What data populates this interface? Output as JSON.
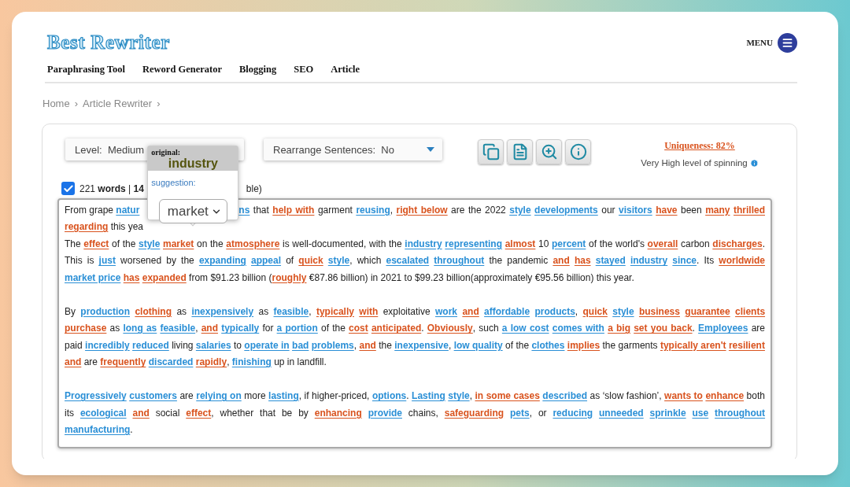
{
  "logo": "Best Rewriter",
  "menu": {
    "label": "MENU"
  },
  "nav": [
    {
      "label": "Paraphrasing Tool"
    },
    {
      "label": "Reword Generator"
    },
    {
      "label": "Blogging"
    },
    {
      "label": "SEO"
    },
    {
      "label": "Article"
    }
  ],
  "breadcrumb": [
    {
      "label": "Home",
      "sep": "›"
    },
    {
      "label": "Article Rewriter",
      "sep": "›"
    }
  ],
  "controls": {
    "level": "Level:  Medium",
    "rearrange": "Rearrange Sentences:  No",
    "tools": [
      {
        "kind": "copy"
      },
      {
        "kind": "document"
      },
      {
        "kind": "zoom"
      },
      {
        "kind": "info"
      }
    ],
    "uniqueness": "Uniqueness: 82%",
    "spinning": "Very High level of spinning"
  },
  "status": {
    "checked": true,
    "before": "221 **words** | **14**",
    "after": "ble)"
  },
  "popup": {
    "original_label": "original:",
    "original_word": "industry",
    "suggestion_label": "suggestion:",
    "suggestion": "market"
  },
  "text_box": {
    "blocks": [
      {
        "kind": "lines",
        "lines": [
          {
            "segments": [
              [
                {
                  "t": "From grape "
                },
                {
                  "t": "natur",
                  "color": "#2a8fd6"
                }
              ],
              [
                {
                  "t": "ns",
                  "color": "#2a8fd6"
                },
                {
                  "t": " that "
                },
                {
                  "t": "help with",
                  "color": "#d9531e"
                },
                {
                  "t": " garment "
                },
                {
                  "t": "reusing",
                  "color": "#2a8fd6"
                },
                {
                  "t": ", "
                },
                {
                  "t": "right below",
                  "color": "#d9531e"
                },
                {
                  "t": " are the 2022 "
                },
                {
                  "t": "style",
                  "color": "#2a8fd6",
                  "space_after": true
                },
                {
                  "t": "developments",
                  "color": "#2a8fd6"
                },
                {
                  "t": " our "
                },
                {
                  "t": "visitors",
                  "color": "#2a8fd6",
                  "space_after": true
                },
                {
                  "t": "have",
                  "color": "#d9531e"
                },
                {
                  "t": " been "
                },
                {
                  "t": "many",
                  "color": "#d9531e",
                  "space_after": true
                },
                {
                  "t": "thrilled",
                  "color": "#d9531e"
                }
              ]
            ]
          },
          {
            "segments": [
              [
                {
                  "t": "regarding",
                  "color": "#d9531e"
                },
                {
                  "t": " this yea"
                }
              ]
            ]
          }
        ]
      },
      {
        "kind": "continued",
        "tokens": [
          {
            "t": "The "
          },
          {
            "t": "effect",
            "color": "#d9531e"
          },
          {
            "t": " of the "
          },
          {
            "t": "style",
            "color": "#2a8fd6",
            "space_after": true
          },
          {
            "t": "market",
            "color": "#d9531e"
          },
          {
            "t": " on the "
          },
          {
            "t": "atmosphere",
            "color": "#d9531e"
          },
          {
            "t": " is well-documented, with the "
          },
          {
            "t": "industry",
            "color": "#2a8fd6",
            "space_after": true
          },
          {
            "t": "representing",
            "color": "#2a8fd6",
            "space_after": true
          },
          {
            "t": "almost",
            "color": "#d9531e"
          },
          {
            "t": " 10 "
          },
          {
            "t": "percent",
            "color": "#2a8fd6"
          },
          {
            "t": " of the world's "
          },
          {
            "t": "overall",
            "color": "#d9531e"
          },
          {
            "t": " carbon "
          },
          {
            "t": "discharges",
            "color": "#d9531e"
          },
          {
            "t": ". This is "
          },
          {
            "t": "just",
            "color": "#2a8fd6"
          },
          {
            "t": " worsened by the "
          },
          {
            "t": "expanding",
            "color": "#2a8fd6",
            "space_after": true
          },
          {
            "t": "appeal",
            "color": "#2a8fd6"
          },
          {
            "t": " of "
          },
          {
            "t": "quick",
            "color": "#d9531e",
            "space_after": true
          },
          {
            "t": "style",
            "color": "#2a8fd6"
          },
          {
            "t": ", which "
          },
          {
            "t": "escalated",
            "color": "#2a8fd6",
            "space_after": true
          },
          {
            "t": "throughout",
            "color": "#2a8fd6"
          },
          {
            "t": " the pandemic "
          },
          {
            "t": "and",
            "color": "#d9531e",
            "space_after": true
          },
          {
            "t": "has",
            "color": "#d9531e",
            "space_after": true
          },
          {
            "t": "stayed",
            "color": "#2a8fd6",
            "space_after": true
          },
          {
            "t": "industry",
            "color": "#2a8fd6",
            "space_after": true
          },
          {
            "t": "since",
            "color": "#2a8fd6"
          },
          {
            "t": ". Its "
          },
          {
            "t": "worldwide",
            "color": "#d9531e",
            "space_after": true
          },
          {
            "t": "market price",
            "color": "#2a8fd6",
            "space_after": true
          },
          {
            "t": "has",
            "color": "#d9531e",
            "space_after": true
          },
          {
            "t": "expanded",
            "color": "#d9531e"
          },
          {
            "t": " from $91.23 billion ("
          },
          {
            "t": "roughly",
            "color": "#d9531e"
          },
          {
            "t": " €87.86 billion) in 2021 to $99.23 billion(approximately €95.56 billion) this year."
          }
        ]
      },
      {
        "kind": "paragraph",
        "tokens": [
          {
            "t": "By "
          },
          {
            "t": "production",
            "color": "#2a8fd6",
            "space_after": true
          },
          {
            "t": "clothing",
            "color": "#d9531e"
          },
          {
            "t": " as "
          },
          {
            "t": "inexpensively",
            "color": "#2a8fd6"
          },
          {
            "t": " as "
          },
          {
            "t": "feasible",
            "color": "#2a8fd6"
          },
          {
            "t": ", "
          },
          {
            "t": "typically",
            "color": "#d9531e",
            "space_after": true
          },
          {
            "t": "with",
            "color": "#d9531e"
          },
          {
            "t": " exploitative "
          },
          {
            "t": "work",
            "color": "#2a8fd6",
            "space_after": true
          },
          {
            "t": "and",
            "color": "#d9531e",
            "space_after": true
          },
          {
            "t": "affordable",
            "color": "#2a8fd6",
            "space_after": true
          },
          {
            "t": "products",
            "color": "#2a8fd6"
          },
          {
            "t": ", "
          },
          {
            "t": "quick",
            "color": "#d9531e",
            "space_after": true
          },
          {
            "t": "style",
            "color": "#2a8fd6",
            "space_after": true
          },
          {
            "t": "business",
            "color": "#d9531e",
            "space_after": true
          },
          {
            "t": "guarantee",
            "color": "#d9531e",
            "space_after": true
          },
          {
            "t": "clients",
            "color": "#d9531e",
            "space_after": true
          },
          {
            "t": "purchase",
            "color": "#d9531e"
          },
          {
            "t": " as "
          },
          {
            "t": "long as",
            "color": "#2a8fd6",
            "space_after": true
          },
          {
            "t": "feasible",
            "color": "#2a8fd6"
          },
          {
            "t": ", "
          },
          {
            "t": "and",
            "color": "#d9531e",
            "space_after": true
          },
          {
            "t": "typically",
            "color": "#2a8fd6"
          },
          {
            "t": " for "
          },
          {
            "t": "a portion",
            "color": "#2a8fd6"
          },
          {
            "t": " of the "
          },
          {
            "t": "cost",
            "color": "#d9531e",
            "space_after": true
          },
          {
            "t": "anticipated",
            "color": "#d9531e"
          },
          {
            "t": ". "
          },
          {
            "t": "Obviously",
            "color": "#d9531e"
          },
          {
            "t": ", such "
          },
          {
            "t": "a low cost",
            "color": "#2a8fd6",
            "space_after": true
          },
          {
            "t": "comes with",
            "color": "#2a8fd6",
            "space_after": true
          },
          {
            "t": "a big",
            "color": "#d9531e",
            "space_after": true
          },
          {
            "t": "set you back",
            "color": "#d9531e"
          },
          {
            "t": ". "
          },
          {
            "t": "Employees",
            "color": "#2a8fd6"
          },
          {
            "t": " are paid "
          },
          {
            "t": "incredibly",
            "color": "#2a8fd6",
            "space_after": true
          },
          {
            "t": "reduced",
            "color": "#2a8fd6"
          },
          {
            "t": " living "
          },
          {
            "t": "salaries",
            "color": "#2a8fd6"
          },
          {
            "t": " to "
          },
          {
            "t": "operate in",
            "color": "#2a8fd6",
            "space_after": true
          },
          {
            "t": "bad",
            "color": "#2a8fd6",
            "space_after": true
          },
          {
            "t": "problems",
            "color": "#2a8fd6"
          },
          {
            "t": ", "
          },
          {
            "t": "and",
            "color": "#d9531e"
          },
          {
            "t": " the "
          },
          {
            "t": "inexpensive",
            "color": "#2a8fd6"
          },
          {
            "t": ", "
          },
          {
            "t": "low quality",
            "color": "#2a8fd6"
          },
          {
            "t": " of the "
          },
          {
            "t": "clothes",
            "color": "#2a8fd6",
            "space_after": true
          },
          {
            "t": "implies",
            "color": "#d9531e"
          },
          {
            "t": " the garments "
          },
          {
            "t": "typically aren't",
            "color": "#d9531e",
            "space_after": true
          },
          {
            "t": "resilient",
            "color": "#d9531e",
            "space_after": true
          },
          {
            "t": "and",
            "color": "#d9531e"
          },
          {
            "t": " are "
          },
          {
            "t": "frequently",
            "color": "#d9531e",
            "space_after": true
          },
          {
            "t": "discarded",
            "color": "#2a8fd6",
            "space_after": true
          },
          {
            "t": "rapidly",
            "color": "#d9531e"
          },
          {
            "t": ", "
          },
          {
            "t": "finishing",
            "color": "#2a8fd6"
          },
          {
            "t": " up in landfill."
          }
        ]
      },
      {
        "kind": "paragraph",
        "tokens": [
          {
            "t": "Progressively",
            "color": "#2a8fd6",
            "space_after": true
          },
          {
            "t": "customers",
            "color": "#2a8fd6"
          },
          {
            "t": " are "
          },
          {
            "t": "relying on",
            "color": "#2a8fd6"
          },
          {
            "t": " more "
          },
          {
            "t": "lasting",
            "color": "#2a8fd6"
          },
          {
            "t": ", if higher-priced, "
          },
          {
            "t": "options",
            "color": "#2a8fd6"
          },
          {
            "t": ". "
          },
          {
            "t": "Lasting",
            "color": "#2a8fd6",
            "space_after": true
          },
          {
            "t": "style",
            "color": "#2a8fd6"
          },
          {
            "t": ", "
          },
          {
            "t": "in some cases",
            "color": "#d9531e",
            "space_after": true
          },
          {
            "t": "described",
            "color": "#2a8fd6"
          },
          {
            "t": " as ‘slow fashion’, "
          },
          {
            "t": "wants to",
            "color": "#d9531e",
            "space_after": true
          },
          {
            "t": "enhance",
            "color": "#d9531e"
          },
          {
            "t": " both its "
          },
          {
            "t": "ecological",
            "color": "#2a8fd6",
            "space_after": true
          },
          {
            "t": "and",
            "color": "#d9531e"
          },
          {
            "t": " social "
          },
          {
            "t": "effect",
            "color": "#d9531e"
          },
          {
            "t": ", whether that be by "
          },
          {
            "t": "enhancing",
            "color": "#d9531e",
            "space_after": true
          },
          {
            "t": "provide",
            "color": "#2a8fd6"
          },
          {
            "t": " chains, "
          },
          {
            "t": "safeguarding",
            "color": "#d9531e",
            "space_after": true
          },
          {
            "t": "pets",
            "color": "#2a8fd6"
          },
          {
            "t": ", or "
          },
          {
            "t": "reducing",
            "color": "#2a8fd6",
            "space_after": true
          },
          {
            "t": "unneeded",
            "color": "#2a8fd6",
            "space_after": true
          },
          {
            "t": "sprinkle",
            "color": "#2a8fd6",
            "space_after": true
          },
          {
            "t": "use",
            "color": "#2a8fd6",
            "space_after": true
          },
          {
            "t": "throughout",
            "color": "#2a8fd6",
            "space_after": true
          },
          {
            "t": "manufacturing",
            "color": "#2a8fd6"
          },
          {
            "t": "."
          }
        ]
      }
    ]
  }
}
